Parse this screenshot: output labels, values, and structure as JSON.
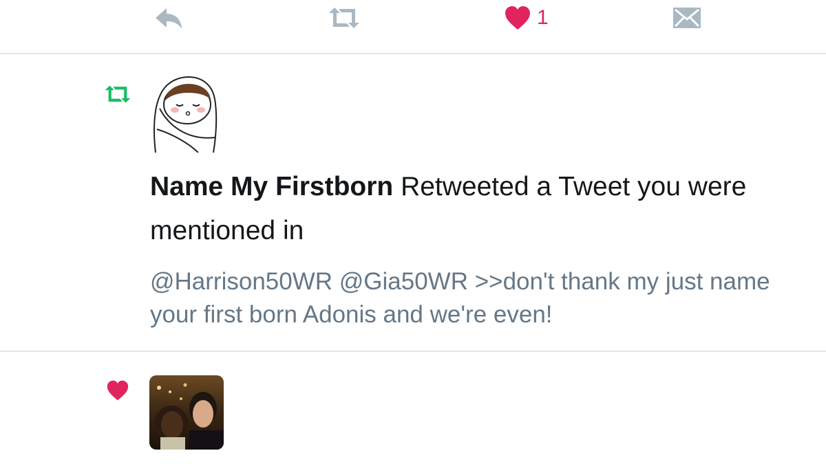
{
  "action_bar": {
    "reply_icon": "reply-icon",
    "retweet_icon": "retweet-icon",
    "like_icon": "heart-icon",
    "like_count": "1",
    "dm_icon": "envelope-icon"
  },
  "notifications": [
    {
      "type_icon": "retweet-icon",
      "avatar": "swaddled-baby-avatar",
      "actor_name": "Name My Firstborn",
      "action_text": " Retweeted a Tweet you were mentioned in",
      "tweet_text": "@Harrison50WR @Gia50WR >>don't thank my just name your first born Adonis and we're even!"
    },
    {
      "type_icon": "heart-icon",
      "avatar": "photo-avatar"
    }
  ],
  "colors": {
    "icon_gray": "#aab8c2",
    "like_red": "#e0245e",
    "retweet_green": "#17bf63",
    "text_primary": "#14171a",
    "text_secondary": "#657786",
    "divider": "#e1e8ed"
  }
}
